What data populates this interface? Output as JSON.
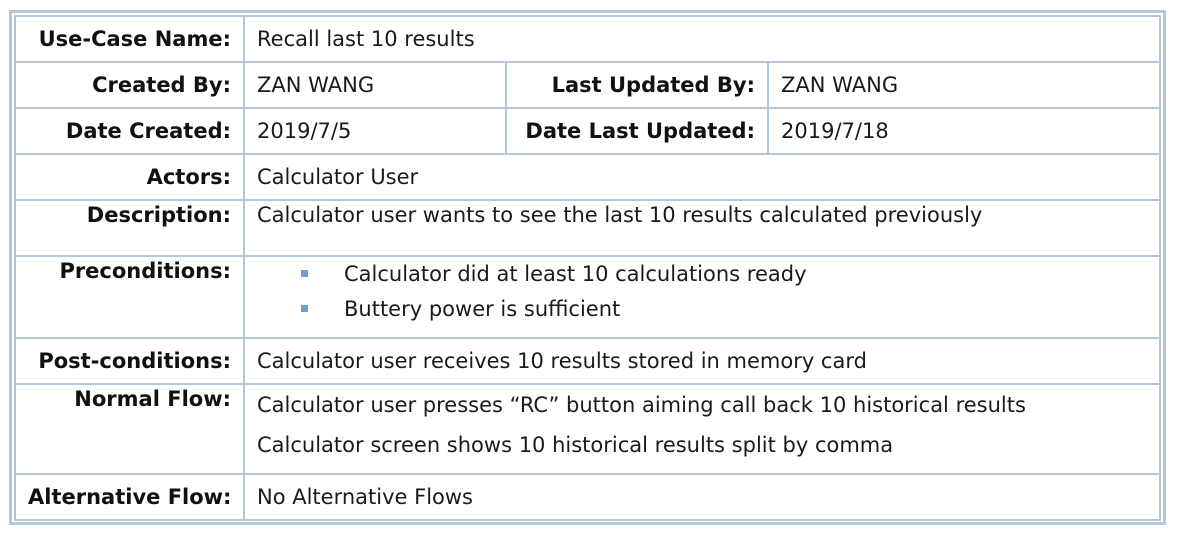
{
  "use_case_name": {
    "label": "Use-Case Name:",
    "value": "Recall last 10 results"
  },
  "created_by": {
    "label": "Created By:",
    "value": "ZAN WANG"
  },
  "last_updated_by": {
    "label": "Last Updated By:",
    "value": "ZAN WANG"
  },
  "date_created": {
    "label": "Date Created:",
    "value": "2019/7/5"
  },
  "date_last_updated": {
    "label": "Date Last Updated:",
    "value": "2019/7/18"
  },
  "actors": {
    "label": "Actors:",
    "value": "Calculator User"
  },
  "description": {
    "label": "Description:",
    "value": "Calculator user wants to see the last 10 results calculated previously"
  },
  "preconditions": {
    "label": "Preconditions:",
    "items": [
      "Calculator did at least 10 calculations ready",
      "Buttery power is sufficient"
    ]
  },
  "post_conditions": {
    "label": "Post-conditions:",
    "value": "Calculator user receives 10 results stored in memory card"
  },
  "normal_flow": {
    "label": "Normal Flow:",
    "steps": [
      "Calculator user presses “RC” button aiming call back 10 historical results",
      "Calculator screen shows 10 historical results split by comma"
    ]
  },
  "alternative_flow": {
    "label": "Alternative Flow:",
    "value": "No Alternative Flows"
  },
  "colors": {
    "border": "#b4c8dc",
    "bullet": "#6a9fd0"
  },
  "icons": {
    "bullet": "square-bullet-icon"
  }
}
